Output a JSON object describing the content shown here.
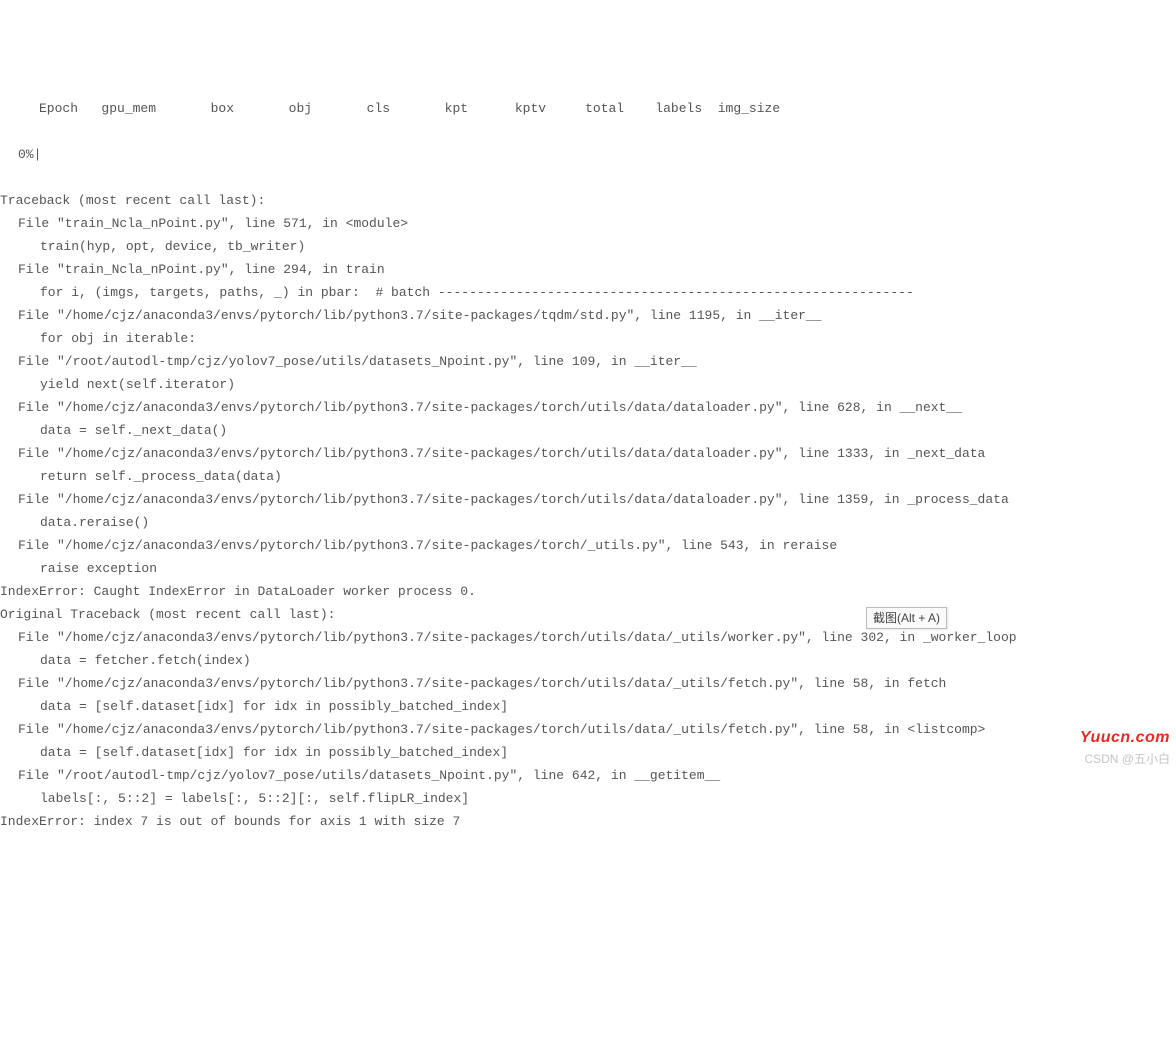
{
  "header": "     Epoch   gpu_mem       box       obj       cls       kpt      kptv     total    labels  img_size",
  "progress": "0%|",
  "lines": [
    {
      "cls": "tb-line",
      "text": "Traceback (most recent call last):"
    },
    {
      "cls": "indent1",
      "text": "File \"train_Ncla_nPoint.py\", line 571, in <module>"
    },
    {
      "cls": "indent2",
      "text": "train(hyp, opt, device, tb_writer)"
    },
    {
      "cls": "indent1",
      "text": "File \"train_Ncla_nPoint.py\", line 294, in train"
    },
    {
      "cls": "indent2",
      "text": "for i, (imgs, targets, paths, _) in pbar:  # batch -------------------------------------------------------------"
    },
    {
      "cls": "indent1",
      "text": "File \"/home/cjz/anaconda3/envs/pytorch/lib/python3.7/site-packages/tqdm/std.py\", line 1195, in __iter__"
    },
    {
      "cls": "indent2",
      "text": "for obj in iterable:"
    },
    {
      "cls": "indent1",
      "text": "File \"/root/autodl-tmp/cjz/yolov7_pose/utils/datasets_Npoint.py\", line 109, in __iter__"
    },
    {
      "cls": "indent2",
      "text": "yield next(self.iterator)"
    },
    {
      "cls": "indent1",
      "text": "File \"/home/cjz/anaconda3/envs/pytorch/lib/python3.7/site-packages/torch/utils/data/dataloader.py\", line 628, in __next__"
    },
    {
      "cls": "indent2",
      "text": "data = self._next_data()"
    },
    {
      "cls": "indent1",
      "text": "File \"/home/cjz/anaconda3/envs/pytorch/lib/python3.7/site-packages/torch/utils/data/dataloader.py\", line 1333, in _next_data"
    },
    {
      "cls": "indent2",
      "text": "return self._process_data(data)"
    },
    {
      "cls": "indent1",
      "text": "File \"/home/cjz/anaconda3/envs/pytorch/lib/python3.7/site-packages/torch/utils/data/dataloader.py\", line 1359, in _process_data"
    },
    {
      "cls": "indent2",
      "text": "data.reraise()"
    },
    {
      "cls": "indent1",
      "text": "File \"/home/cjz/anaconda3/envs/pytorch/lib/python3.7/site-packages/torch/_utils.py\", line 543, in reraise"
    },
    {
      "cls": "indent2",
      "text": "raise exception"
    },
    {
      "cls": "tb-line",
      "text": "IndexError: Caught IndexError in DataLoader worker process 0."
    },
    {
      "cls": "tb-line",
      "text": "Original Traceback (most recent call last):"
    },
    {
      "cls": "indent1",
      "text": "File \"/home/cjz/anaconda3/envs/pytorch/lib/python3.7/site-packages/torch/utils/data/_utils/worker.py\", line 302, in _worker_loop"
    },
    {
      "cls": "indent2",
      "text": "data = fetcher.fetch(index)"
    },
    {
      "cls": "indent1",
      "text": "File \"/home/cjz/anaconda3/envs/pytorch/lib/python3.7/site-packages/torch/utils/data/_utils/fetch.py\", line 58, in fetch"
    },
    {
      "cls": "indent2",
      "text": "data = [self.dataset[idx] for idx in possibly_batched_index]"
    },
    {
      "cls": "indent1",
      "text": "File \"/home/cjz/anaconda3/envs/pytorch/lib/python3.7/site-packages/torch/utils/data/_utils/fetch.py\", line 58, in <listcomp>"
    },
    {
      "cls": "indent2",
      "text": "data = [self.dataset[idx] for idx in possibly_batched_index]"
    },
    {
      "cls": "indent1",
      "text": "File \"/root/autodl-tmp/cjz/yolov7_pose/utils/datasets_Npoint.py\", line 642, in __getitem__"
    },
    {
      "cls": "indent2",
      "text": "labels[:, 5::2] = labels[:, 5::2][:, self.flipLR_index]"
    },
    {
      "cls": "tb-line",
      "text": "IndexError: index 7 is out of bounds for axis 1 with size 7"
    }
  ],
  "tooltip": "截图(Alt + A)",
  "watermark_red": "Yuucn.com",
  "watermark_gray": "CSDN @五小白"
}
